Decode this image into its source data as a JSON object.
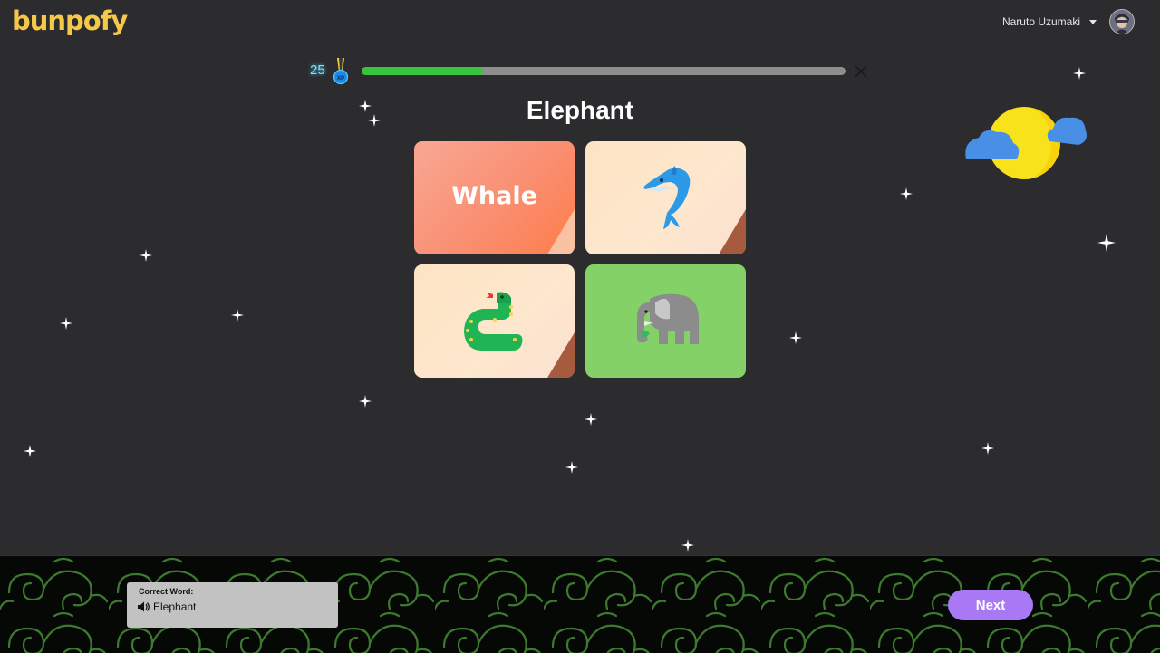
{
  "header": {
    "logo": "bunpofy",
    "user_name": "Naruto Uzumaki"
  },
  "progress": {
    "xp_count": "25",
    "xp_badge": "XP",
    "fraction": 0.25
  },
  "question": {
    "word": "Elephant"
  },
  "options": [
    {
      "type": "text",
      "label": "Whale"
    },
    {
      "type": "icon",
      "icon": "dolphin-icon"
    },
    {
      "type": "icon",
      "icon": "snake-icon"
    },
    {
      "type": "icon",
      "icon": "elephant-icon",
      "state": "correct"
    }
  ],
  "feedback": {
    "label": "Correct Word:",
    "word": "Elephant"
  },
  "actions": {
    "next_label": "Next"
  },
  "colors": {
    "accent_button": "#a979f5",
    "correct": "#84d167",
    "progress_fill": "#39c43d",
    "logo": "#f5c84a"
  }
}
